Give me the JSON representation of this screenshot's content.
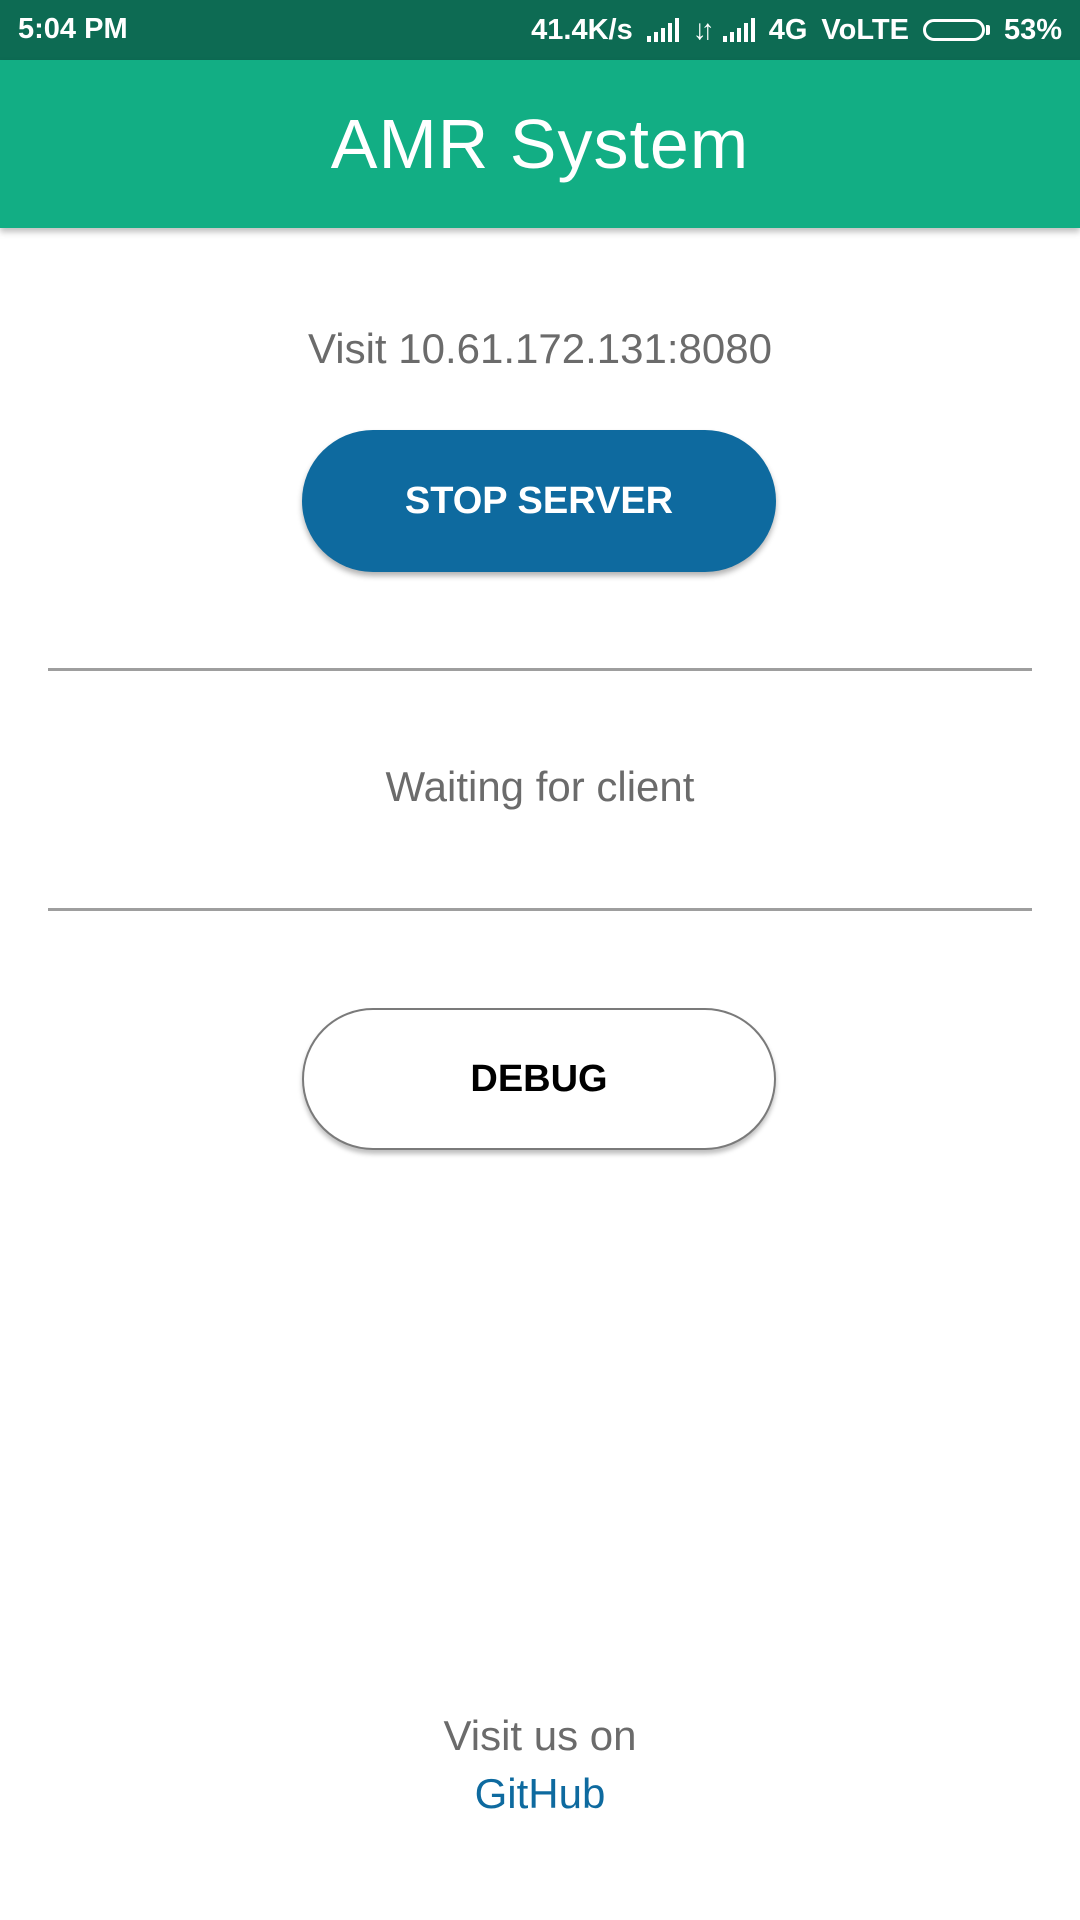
{
  "status_bar": {
    "time": "5:04 PM",
    "net_speed": "41.4K/s",
    "network_type": "4G",
    "volte": "VoLTE",
    "battery_percent": "53%",
    "battery_level": 0.53
  },
  "app_bar": {
    "title": "AMR System"
  },
  "main": {
    "address_text": "Visit 10.61.172.131:8080",
    "stop_button_label": "STOP SERVER",
    "status_text": "Waiting for client",
    "debug_button_label": "DEBUG"
  },
  "footer": {
    "visit_text": "Visit us on",
    "github_link": "GitHub"
  },
  "colors": {
    "status_bar": "#0d6b53",
    "app_bar": "#12ae84",
    "primary_button": "#0e6a9f",
    "link": "#0e6a9f"
  }
}
